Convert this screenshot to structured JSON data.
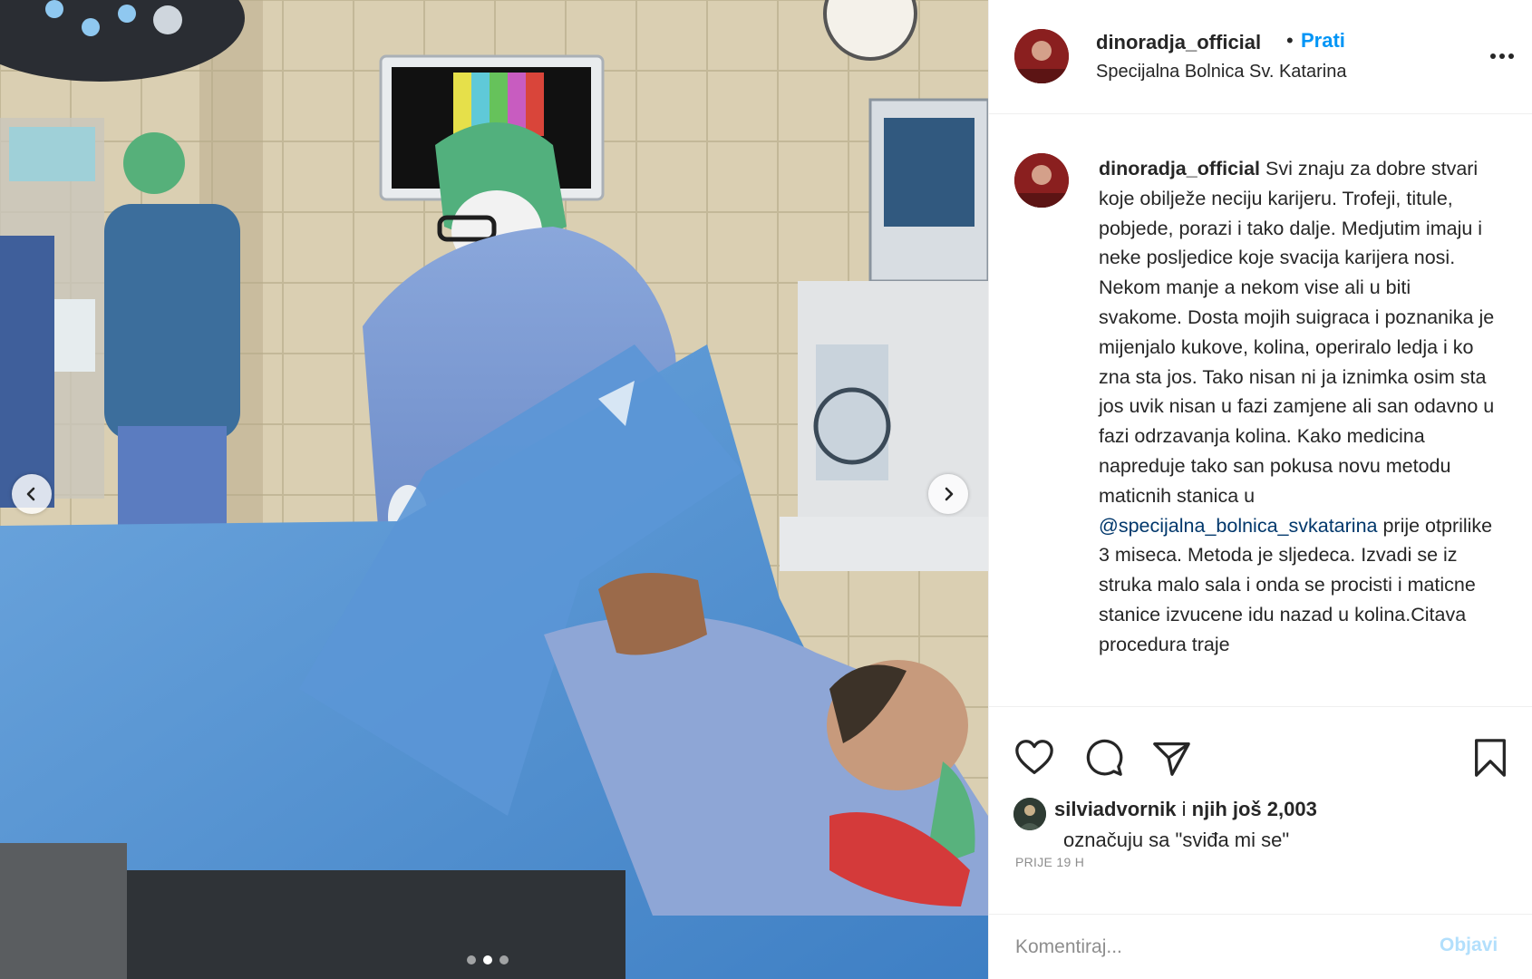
{
  "post": {
    "username": "dinoradja_official",
    "separator": "•",
    "follow_label": "Prati",
    "location": "Specijalna Bolnica Sv. Katarina",
    "more_icon": "more-options-icon"
  },
  "caption": {
    "username": "dinoradja_official",
    "text_before_mention": " Svi znaju za dobre stvari koje obilježe neciju karijeru. Trofeji, titule, pobjede, porazi i tako dalje. Medjutim imaju i neke posljedice koje svacija karijera nosi. Nekom manje a nekom vise ali u biti svakome. Dosta mojih suigraca i poznanika je mijenjalo kukove, kolina, operiralo ledja i ko zna sta jos. Tako nisan ni ja iznimka osim sta jos uvik nisan u fazi zamjene ali san odavno u fazi odrzavanja kolina. Kako medicina napreduje tako san pokusa novu metodu maticnih stanica u ",
    "mention": "@specijalna_bolnica_svkatarina",
    "text_after_mention": " prije otprilike 3 miseca. Metoda je sljedeca. Izvadi se iz struka malo sala i onda se procisti i maticne stanice izvucene idu nazad u kolina.Citava procedura traje"
  },
  "actions": {
    "like_icon": "heart-icon",
    "comment_icon": "comment-icon",
    "share_icon": "paper-plane-icon",
    "save_icon": "bookmark-icon"
  },
  "likes": {
    "liker": "silviadvornik",
    "connector": "i",
    "others": "njih još 2,003",
    "line2": "označuju sa \"sviđa mi se\""
  },
  "timestamp": "PRIJE 19 H",
  "comment": {
    "placeholder": "Komentiraj...",
    "post_label": "Objavi"
  },
  "carousel": {
    "total": 3,
    "active_index": 1
  },
  "colors": {
    "accent": "#0095f6",
    "post_disabled": "#b2dffc",
    "text": "#262626",
    "muted": "#8e8e8e",
    "border": "#efefef"
  }
}
